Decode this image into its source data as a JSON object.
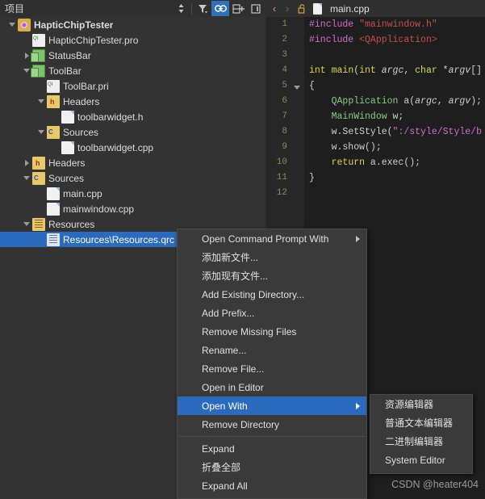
{
  "panel": {
    "title": "项目",
    "toolbar": [
      {
        "name": "sort-icon",
        "glyph": "⇅",
        "active": false
      },
      {
        "name": "filter-icon",
        "glyph": "▼",
        "active": false
      },
      {
        "name": "link-icon",
        "glyph": "⚭",
        "active": true
      },
      {
        "name": "split-add-icon",
        "glyph": "⊞",
        "active": false
      },
      {
        "name": "close-panel-icon",
        "glyph": "▣",
        "active": false
      }
    ]
  },
  "tree": [
    {
      "label": "HapticChipTester",
      "indent": 0,
      "twist": "open",
      "icon": "ic-proj",
      "bold": true,
      "selected": false
    },
    {
      "label": "HapticChipTester.pro",
      "indent": 1,
      "twist": "none",
      "icon": "ic-pro",
      "bold": false,
      "selected": false
    },
    {
      "label": "StatusBar",
      "indent": 1,
      "twist": "closed",
      "icon": "ic-sub",
      "bold": false,
      "selected": false
    },
    {
      "label": "ToolBar",
      "indent": 1,
      "twist": "open",
      "icon": "ic-sub",
      "bold": false,
      "selected": false
    },
    {
      "label": "ToolBar.pri",
      "indent": 2,
      "twist": "none",
      "icon": "ic-pri",
      "bold": false,
      "selected": false
    },
    {
      "label": "Headers",
      "indent": 2,
      "twist": "open",
      "icon": "ic-hdr",
      "bold": false,
      "selected": false
    },
    {
      "label": "toolbarwidget.h",
      "indent": 3,
      "twist": "none",
      "icon": "ic-file",
      "bold": false,
      "selected": false
    },
    {
      "label": "Sources",
      "indent": 2,
      "twist": "open",
      "icon": "ic-src",
      "bold": false,
      "selected": false
    },
    {
      "label": "toolbarwidget.cpp",
      "indent": 3,
      "twist": "none",
      "icon": "ic-file",
      "bold": false,
      "selected": false
    },
    {
      "label": "Headers",
      "indent": 1,
      "twist": "closed",
      "icon": "ic-hdr",
      "bold": false,
      "selected": false
    },
    {
      "label": "Sources",
      "indent": 1,
      "twist": "open",
      "icon": "ic-src",
      "bold": false,
      "selected": false
    },
    {
      "label": "main.cpp",
      "indent": 2,
      "twist": "none",
      "icon": "ic-file",
      "bold": false,
      "selected": false
    },
    {
      "label": "mainwindow.cpp",
      "indent": 2,
      "twist": "none",
      "icon": "ic-file",
      "bold": false,
      "selected": false
    },
    {
      "label": "Resources",
      "indent": 1,
      "twist": "open",
      "icon": "ic-res",
      "bold": false,
      "selected": false
    },
    {
      "label": "Resources\\Resources.qrc",
      "indent": 2,
      "twist": "none",
      "icon": "ic-qrc",
      "bold": false,
      "selected": true
    }
  ],
  "editor": {
    "tab_title": "main.cpp",
    "back_glyph": "‹",
    "forward_glyph": "›",
    "lock_glyph": "🔓",
    "line_numbers": [
      "1",
      "2",
      "3",
      "4",
      "5",
      "6",
      "7",
      "8",
      "9",
      "10",
      "11",
      "12"
    ],
    "code_lines": [
      {
        "n": 1,
        "tokens": [
          {
            "t": "#include ",
            "c": "tk-pre"
          },
          {
            "t": "\"mainwindow.h\"",
            "c": "tk-str"
          }
        ]
      },
      {
        "n": 2,
        "tokens": [
          {
            "t": "#include ",
            "c": "tk-pre"
          },
          {
            "t": "<QApplication>",
            "c": "tk-str"
          }
        ]
      },
      {
        "n": 3,
        "tokens": []
      },
      {
        "n": 4,
        "tokens": [
          {
            "t": "int ",
            "c": "tk-kw"
          },
          {
            "t": "main",
            "c": "tk-kw"
          },
          {
            "t": "(",
            "c": "tk-punct"
          },
          {
            "t": "int ",
            "c": "tk-kw"
          },
          {
            "t": "argc",
            "c": "tk-param"
          },
          {
            "t": ", ",
            "c": "tk-punct"
          },
          {
            "t": "char ",
            "c": "tk-kw"
          },
          {
            "t": "*",
            "c": "tk-punct"
          },
          {
            "t": "argv",
            "c": "tk-param"
          },
          {
            "t": "[]",
            "c": "tk-punct"
          }
        ],
        "fold": true
      },
      {
        "n": 5,
        "tokens": [
          {
            "t": "{",
            "c": "tk-punct"
          }
        ]
      },
      {
        "n": 6,
        "tokens": [
          {
            "t": "    ",
            "c": "tk-punct"
          },
          {
            "t": "QApplication",
            "c": "tk-green"
          },
          {
            "t": " a(",
            "c": "tk-punct"
          },
          {
            "t": "argc",
            "c": "tk-param"
          },
          {
            "t": ", ",
            "c": "tk-punct"
          },
          {
            "t": "argv",
            "c": "tk-param"
          },
          {
            "t": ");",
            "c": "tk-punct"
          }
        ]
      },
      {
        "n": 7,
        "tokens": [
          {
            "t": "    ",
            "c": "tk-punct"
          },
          {
            "t": "MainWindow",
            "c": "tk-green"
          },
          {
            "t": " w;",
            "c": "tk-punct"
          }
        ]
      },
      {
        "n": 8,
        "tokens": [
          {
            "t": "    w.",
            "c": "tk-punct"
          },
          {
            "t": "SetStyle",
            "c": "tk-punct"
          },
          {
            "t": "(",
            "c": "tk-punct"
          },
          {
            "t": "\":/style/Style/b",
            "c": "tk-magenta"
          }
        ]
      },
      {
        "n": 9,
        "tokens": [
          {
            "t": "    w.show();",
            "c": "tk-punct"
          }
        ]
      },
      {
        "n": 10,
        "tokens": [
          {
            "t": "    ",
            "c": "tk-punct"
          },
          {
            "t": "return ",
            "c": "tk-kw"
          },
          {
            "t": "a.exec();",
            "c": "tk-punct"
          }
        ]
      },
      {
        "n": 11,
        "tokens": [
          {
            "t": "}",
            "c": "tk-punct"
          }
        ]
      },
      {
        "n": 12,
        "tokens": []
      }
    ]
  },
  "context_menu": {
    "items": [
      {
        "label": "Open Command Prompt With",
        "submenu": true,
        "highlight": false,
        "sep_after": false
      },
      {
        "label": "添加新文件...",
        "submenu": false,
        "highlight": false,
        "sep_after": false
      },
      {
        "label": "添加现有文件...",
        "submenu": false,
        "highlight": false,
        "sep_after": false
      },
      {
        "label": "Add Existing Directory...",
        "submenu": false,
        "highlight": false,
        "sep_after": false
      },
      {
        "label": "Add Prefix...",
        "submenu": false,
        "highlight": false,
        "sep_after": false
      },
      {
        "label": "Remove Missing Files",
        "submenu": false,
        "highlight": false,
        "sep_after": false
      },
      {
        "label": "Rename...",
        "submenu": false,
        "highlight": false,
        "sep_after": false
      },
      {
        "label": "Remove File...",
        "submenu": false,
        "highlight": false,
        "sep_after": false
      },
      {
        "label": "Open in Editor",
        "submenu": false,
        "highlight": false,
        "sep_after": false
      },
      {
        "label": "Open With",
        "submenu": true,
        "highlight": true,
        "sep_after": false
      },
      {
        "label": "Remove Directory",
        "submenu": false,
        "highlight": false,
        "sep_after": true
      },
      {
        "label": "Expand",
        "submenu": false,
        "highlight": false,
        "sep_after": false
      },
      {
        "label": "折叠全部",
        "submenu": false,
        "highlight": false,
        "sep_after": false
      },
      {
        "label": "Expand All",
        "submenu": false,
        "highlight": false,
        "sep_after": false
      }
    ]
  },
  "sub_menu": {
    "items": [
      {
        "label": "资源编辑器"
      },
      {
        "label": "普通文本编辑器"
      },
      {
        "label": "二进制编辑器"
      },
      {
        "label": "System Editor"
      }
    ]
  },
  "watermark": "CSDN @heater404",
  "colors": {
    "selection_blue": "#2a6bbd",
    "panel_bg": "#333333",
    "editor_bg": "#1e1e1e",
    "menu_bg": "#3a3a3a",
    "modified_marker_green": "#36a13c"
  }
}
